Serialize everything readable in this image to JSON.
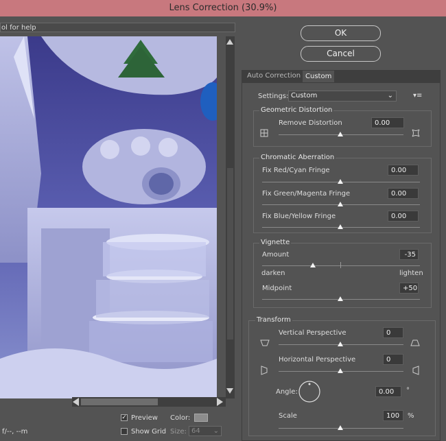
{
  "window": {
    "title": "Lens Correction (30.9%)"
  },
  "hint": {
    "text": "ol for help"
  },
  "buttons": {
    "ok": "OK",
    "cancel": "Cancel"
  },
  "tabs": [
    {
      "label": "Auto Correction",
      "active": false
    },
    {
      "label": "Custom",
      "active": true
    }
  ],
  "settings": {
    "label": "Settings:",
    "value": "Custom"
  },
  "geometric": {
    "title": "Geometric Distortion",
    "remove_label": "Remove Distortion",
    "remove_value": "0.00"
  },
  "chromatic": {
    "title": "Chromatic Aberration",
    "red_label": "Fix Red/Cyan Fringe",
    "red_value": "0.00",
    "green_label": "Fix Green/Magenta Fringe",
    "green_value": "0.00",
    "blue_label": "Fix Blue/Yellow Fringe",
    "blue_value": "0.00"
  },
  "vignette": {
    "title": "Vignette",
    "amount_label": "Amount",
    "amount_value": "-35",
    "darken": "darken",
    "lighten": "lighten",
    "midpoint_label": "Midpoint",
    "midpoint_value": "+50"
  },
  "transform": {
    "title": "Transform",
    "vertical_label": "Vertical Perspective",
    "vertical_value": "0",
    "horizontal_label": "Horizontal Perspective",
    "horizontal_value": "0",
    "angle_label": "Angle:",
    "angle_value": "0.00",
    "angle_unit": "°",
    "scale_label": "Scale",
    "scale_value": "100",
    "scale_unit": "%"
  },
  "bottom": {
    "status": "f/--, --m",
    "preview_label": "Preview",
    "preview_checked": true,
    "showgrid_label": "Show Grid",
    "showgrid_checked": false,
    "color_label": "Color:",
    "size_label": "Size:",
    "size_value": "64"
  },
  "colors": {
    "titlebar": "#c8787e",
    "panel": "#535353",
    "field": "#3a3a3a"
  }
}
